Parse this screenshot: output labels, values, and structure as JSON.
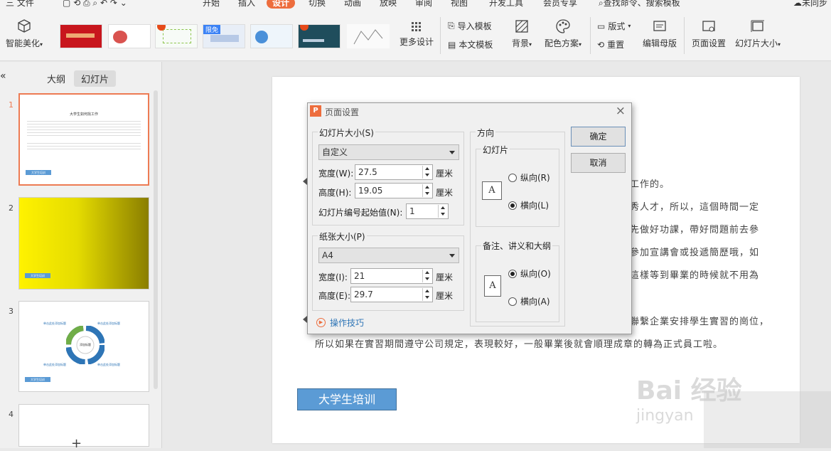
{
  "menu": {
    "file": "三 文件",
    "items": [
      "开始",
      "插入",
      "设计",
      "切换",
      "动画",
      "放映",
      "审阅",
      "视图",
      "开发工具",
      "会员专享"
    ],
    "active": "设计",
    "search": "查找命令、搜索模板",
    "sync": "未同步"
  },
  "ribbon": {
    "smart_beautify": "智能美化",
    "more_design": "更多设计",
    "free_badge": "限免",
    "import_template": "导入模板",
    "text_template": "本文模板",
    "background": "背景",
    "color_scheme": "配色方案",
    "layout": "版式",
    "reset": "重置",
    "edit_master": "编辑母版",
    "page_setup": "页面设置",
    "slide_size": "幻灯片大小"
  },
  "left_panel": {
    "collapse": "«",
    "tab_outline": "大纲",
    "tab_slides": "幻灯片",
    "slide_numbers": [
      "1",
      "2",
      "3",
      "4"
    ],
    "add": "+",
    "thumb1_title": "大学生如何找工作",
    "thumb_button": "大学生培训",
    "thumb3_labels": [
      "单击此处添加标题",
      "单击此处添加标题",
      "单击此处添加标题",
      "单击此处添加标题"
    ],
    "thumb3_center": "添加标题"
  },
  "canvas": {
    "lines": [
      "工作的。",
      "秀人才，所以，這個時間一定",
      "先做好功課，帶好問題前去參",
      "參加宣講會或投遞簡歷哦，如",
      "這樣等到畢業的時候就不用為",
      "聯繫企業安排學生實習的崗位，",
      "所以如果在實習期間遵守公司規定，表現較好，一般畢業後就會順理成章的轉為正式員工啦。"
    ],
    "button": "大学生培训",
    "watermark": "Bai 经验",
    "watermark_sub": "jingyan"
  },
  "dialog": {
    "title": "页面设置",
    "close": "×",
    "slide_size_group": "幻灯片大小(S)",
    "slide_size_value": "自定义",
    "width_label": "宽度(W):",
    "width_value": "27.5",
    "height_label": "高度(H):",
    "height_value": "19.05",
    "unit": "厘米",
    "numbering_label": "幻灯片编号起始值(N):",
    "numbering_value": "1",
    "paper_group": "纸张大小(P)",
    "paper_value": "A4",
    "paper_width_label": "宽度(I):",
    "paper_width_value": "21",
    "paper_height_label": "高度(E):",
    "paper_height_value": "29.7",
    "orientation_group": "方向",
    "slides_sub": "幻灯片",
    "portrait_r": "纵向(R)",
    "landscape_l": "横向(L)",
    "notes_sub": "备注、讲义和大纲",
    "portrait_o": "纵向(O)",
    "landscape_a": "横向(A)",
    "page_glyph": "A",
    "tips": "操作技巧",
    "ok": "确定",
    "cancel": "取消"
  },
  "colors": {
    "accent": "#ed6d3d",
    "selected_border": "#ed7b53",
    "canvas_button": "#5b9bd5"
  }
}
